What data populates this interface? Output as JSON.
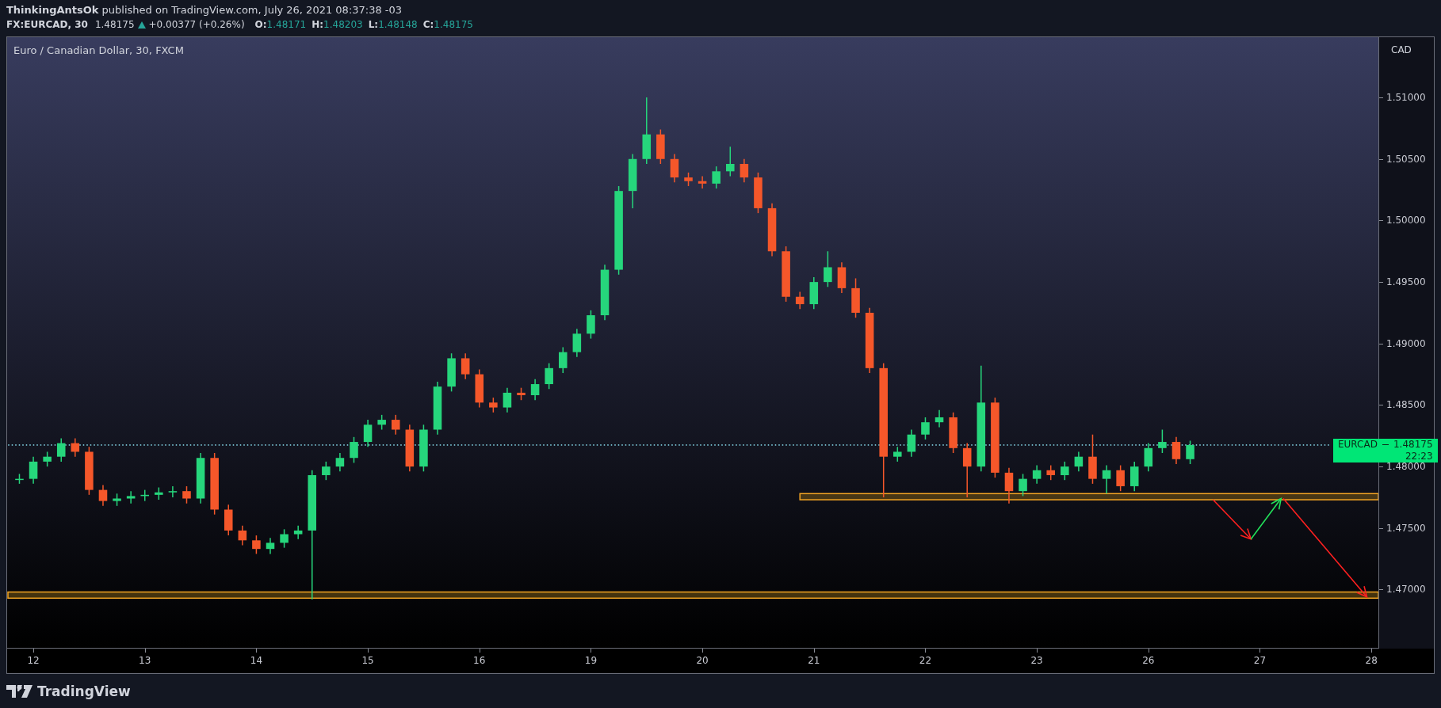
{
  "header": {
    "byline": "**ThinkingAntsOk** published on TradingView.com, July 26, 2021 08:37:38 -03",
    "symbol": "FX:EURCAD, 30",
    "last": "1.48175",
    "rising": true,
    "change": "+0.00377 (+0.26%)",
    "ohlc": [
      {
        "label": "O:",
        "value": "1.48171"
      },
      {
        "label": "H:",
        "value": "1.48203"
      },
      {
        "label": "L:",
        "value": "1.48148"
      },
      {
        "label": "C:",
        "value": "1.48175"
      }
    ]
  },
  "chart": {
    "last_price_tag": {
      "price": "1.48175",
      "countdown": "22:23"
    },
    "chart_data": {
      "type": "candlestick",
      "title": "Euro / Canadian Dollar, 30, FXCM",
      "ylabel": "CAD",
      "ylim": [
        1.4652,
        1.5149
      ],
      "categories": [
        null,
        "12",
        null,
        null,
        null,
        null,
        null,
        null,
        null,
        "13",
        null,
        null,
        null,
        null,
        null,
        null,
        null,
        "14",
        null,
        null,
        null,
        null,
        null,
        null,
        null,
        "15",
        null,
        null,
        null,
        null,
        null,
        null,
        null,
        "16",
        null,
        null,
        null,
        null,
        null,
        null,
        null,
        "19",
        null,
        null,
        null,
        null,
        null,
        null,
        null,
        "20",
        null,
        null,
        null,
        null,
        null,
        null,
        null,
        "21",
        null,
        null,
        null,
        null,
        null,
        null,
        null,
        "22",
        null,
        null,
        null,
        null,
        null,
        null,
        null,
        "23",
        null,
        null,
        null,
        null,
        null,
        null,
        null,
        "26",
        null,
        null,
        null,
        null,
        null,
        null,
        null,
        "27",
        null,
        null,
        null,
        null,
        null,
        null,
        null,
        "28"
      ],
      "yticks": [
        {
          "value": 1.47,
          "label": "1.47000"
        },
        {
          "value": 1.475,
          "label": "1.47500"
        },
        {
          "value": 1.48,
          "label": "1.48000"
        },
        {
          "value": 1.485,
          "label": "1.48500"
        },
        {
          "value": 1.49,
          "label": "1.49000"
        },
        {
          "value": 1.495,
          "label": "1.49500"
        },
        {
          "value": 1.5,
          "label": "1.50000"
        },
        {
          "value": 1.505,
          "label": "1.50500"
        },
        {
          "value": 1.51,
          "label": "1.51000"
        }
      ],
      "series": [
        {
          "name": "EURCAD",
          "ohlc": [
            [
              1.479,
              1.4794,
              1.4786,
              1.479
            ],
            [
              1.479,
              1.4808,
              1.4786,
              1.4804
            ],
            [
              1.4804,
              1.4812,
              1.48,
              1.4808
            ],
            [
              1.4808,
              1.4823,
              1.4804,
              1.4819
            ],
            [
              1.4819,
              1.4823,
              1.4808,
              1.4812
            ],
            [
              1.4812,
              1.4816,
              1.4777,
              1.4781
            ],
            [
              1.4781,
              1.4785,
              1.4768,
              1.4772
            ],
            [
              1.4772,
              1.4778,
              1.4768,
              1.4774
            ],
            [
              1.4774,
              1.478,
              1.477,
              1.4776
            ],
            [
              1.4776,
              1.4781,
              1.4772,
              1.4777
            ],
            [
              1.4777,
              1.4783,
              1.4773,
              1.4779
            ],
            [
              1.4779,
              1.4784,
              1.4775,
              1.478
            ],
            [
              1.478,
              1.4784,
              1.477,
              1.4774
            ],
            [
              1.4774,
              1.4811,
              1.477,
              1.4807
            ],
            [
              1.4807,
              1.4811,
              1.4761,
              1.4765
            ],
            [
              1.4765,
              1.4769,
              1.4744,
              1.4748
            ],
            [
              1.4748,
              1.4752,
              1.4736,
              1.474
            ],
            [
              1.474,
              1.4744,
              1.4729,
              1.4733
            ],
            [
              1.4733,
              1.4742,
              1.4729,
              1.4738
            ],
            [
              1.4738,
              1.4749,
              1.4734,
              1.4745
            ],
            [
              1.4745,
              1.4752,
              1.4741,
              1.4748
            ],
            [
              1.4748,
              1.4797,
              1.4692,
              1.4793
            ],
            [
              1.4793,
              1.4804,
              1.4789,
              1.48
            ],
            [
              1.48,
              1.4811,
              1.4796,
              1.4807
            ],
            [
              1.4807,
              1.4824,
              1.4803,
              1.482
            ],
            [
              1.482,
              1.4838,
              1.4816,
              1.4834
            ],
            [
              1.4834,
              1.4842,
              1.483,
              1.4838
            ],
            [
              1.4838,
              1.4842,
              1.4826,
              1.483
            ],
            [
              1.483,
              1.4834,
              1.4796,
              1.48
            ],
            [
              1.48,
              1.4834,
              1.4796,
              1.483
            ],
            [
              1.483,
              1.4869,
              1.4826,
              1.4865
            ],
            [
              1.4865,
              1.4892,
              1.4861,
              1.4888
            ],
            [
              1.4888,
              1.4892,
              1.4871,
              1.4875
            ],
            [
              1.4875,
              1.4879,
              1.4848,
              1.4852
            ],
            [
              1.4852,
              1.4856,
              1.4844,
              1.4848
            ],
            [
              1.4848,
              1.4864,
              1.4844,
              1.486
            ],
            [
              1.486,
              1.4864,
              1.4854,
              1.4858
            ],
            [
              1.4858,
              1.4871,
              1.4854,
              1.4867
            ],
            [
              1.4867,
              1.4884,
              1.4863,
              1.488
            ],
            [
              1.488,
              1.4897,
              1.4876,
              1.4893
            ],
            [
              1.4893,
              1.4912,
              1.4889,
              1.4908
            ],
            [
              1.4908,
              1.4927,
              1.4904,
              1.4923
            ],
            [
              1.4923,
              1.4964,
              1.4919,
              1.496
            ],
            [
              1.496,
              1.5028,
              1.4956,
              1.5024
            ],
            [
              1.5024,
              1.5054,
              1.501,
              1.505
            ],
            [
              1.505,
              1.51,
              1.5046,
              1.507
            ],
            [
              1.507,
              1.5074,
              1.5046,
              1.505
            ],
            [
              1.505,
              1.5054,
              1.5031,
              1.5035
            ],
            [
              1.5035,
              1.5039,
              1.5028,
              1.5032
            ],
            [
              1.5032,
              1.5036,
              1.5026,
              1.503
            ],
            [
              1.503,
              1.5044,
              1.5026,
              1.504
            ],
            [
              1.504,
              1.506,
              1.5036,
              1.5046
            ],
            [
              1.5046,
              1.505,
              1.5031,
              1.5035
            ],
            [
              1.5035,
              1.5039,
              1.5006,
              1.501
            ],
            [
              1.501,
              1.5014,
              1.4971,
              1.4975
            ],
            [
              1.4975,
              1.4979,
              1.4934,
              1.4938
            ],
            [
              1.4938,
              1.4942,
              1.4928,
              1.4932
            ],
            [
              1.4932,
              1.4954,
              1.4928,
              1.495
            ],
            [
              1.495,
              1.4975,
              1.4946,
              1.4962
            ],
            [
              1.4962,
              1.4966,
              1.4941,
              1.4945
            ],
            [
              1.4945,
              1.4953,
              1.4921,
              1.4925
            ],
            [
              1.4925,
              1.4929,
              1.4876,
              1.488
            ],
            [
              1.488,
              1.4884,
              1.4775,
              1.4808
            ],
            [
              1.4808,
              1.4816,
              1.4804,
              1.4812
            ],
            [
              1.4812,
              1.483,
              1.4808,
              1.4826
            ],
            [
              1.4826,
              1.484,
              1.4822,
              1.4836
            ],
            [
              1.4836,
              1.4846,
              1.4832,
              1.484
            ],
            [
              1.484,
              1.4844,
              1.4811,
              1.4815
            ],
            [
              1.4815,
              1.4819,
              1.4775,
              1.48
            ],
            [
              1.48,
              1.4882,
              1.4796,
              1.4852
            ],
            [
              1.4852,
              1.4856,
              1.4791,
              1.4795
            ],
            [
              1.4795,
              1.4799,
              1.477,
              1.478
            ],
            [
              1.478,
              1.4794,
              1.4776,
              1.479
            ],
            [
              1.479,
              1.4801,
              1.4786,
              1.4797
            ],
            [
              1.4797,
              1.4801,
              1.4789,
              1.4793
            ],
            [
              1.4793,
              1.4804,
              1.4789,
              1.48
            ],
            [
              1.48,
              1.4812,
              1.4796,
              1.4808
            ],
            [
              1.4808,
              1.4826,
              1.4786,
              1.479
            ],
            [
              1.479,
              1.4801,
              1.4778,
              1.4797
            ],
            [
              1.4797,
              1.4801,
              1.478,
              1.4784
            ],
            [
              1.4784,
              1.4804,
              1.478,
              1.48
            ],
            [
              1.48,
              1.4819,
              1.4796,
              1.4815
            ],
            [
              1.4815,
              1.483,
              1.4811,
              1.482
            ],
            [
              1.482,
              1.4824,
              1.4802,
              1.4806
            ],
            [
              1.4806,
              1.4821,
              1.4802,
              1.48175
            ],
            null,
            null,
            null,
            null,
            null,
            null,
            null,
            null,
            null,
            null,
            null,
            null,
            null
          ]
        }
      ]
    }
  },
  "footer": {
    "brand": "TradingView"
  }
}
